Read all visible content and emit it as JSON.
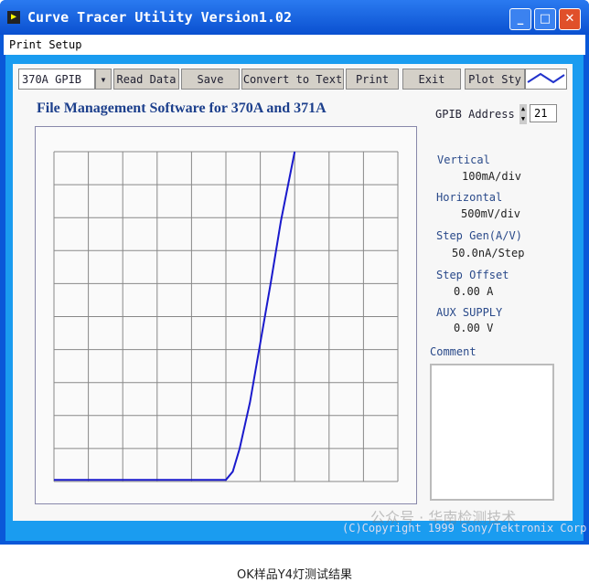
{
  "window": {
    "title": "Curve Tracer Utility Version1.02",
    "controls": [
      "minimize",
      "maximize",
      "close"
    ]
  },
  "menu": {
    "items": [
      "Print Setup"
    ]
  },
  "toolbar": {
    "device_select": "370A GPIB",
    "read": "Read Data",
    "save": "Save",
    "convert": "Convert to Text",
    "print": "Print",
    "exit": "Exit",
    "plot_style": "Plot Sty"
  },
  "heading": "File Management Software for 370A and 371A",
  "gpib": {
    "label": "GPIB Address",
    "value": "21"
  },
  "settings": [
    {
      "label": "Vertical",
      "value": "100mA/div"
    },
    {
      "label": "Horizontal",
      "value": "500mV/div"
    },
    {
      "label": "Step Gen(A/V)",
      "value": "50.0nA/Step"
    },
    {
      "label": "Step Offset",
      "value": "0.00 A"
    },
    {
      "label": "AUX SUPPLY",
      "value": "0.00 V"
    }
  ],
  "comment": {
    "label": "Comment",
    "value": ""
  },
  "copyright": "(C)Copyright 1999 Sony/Tektronix Corp",
  "watermark": "公众号 · 华南检测技术",
  "caption": "OK样品Y4灯测试结果",
  "chart_data": {
    "type": "line",
    "grid": "10x10 divisions",
    "color": "#1a1acc",
    "x_div": [
      0,
      5.0,
      5.2,
      5.4,
      5.7,
      6.0,
      6.3,
      6.6,
      7.0
    ],
    "y_div": [
      0.05,
      0.05,
      0.3,
      1.0,
      2.4,
      4.2,
      6.0,
      7.9,
      10
    ]
  }
}
